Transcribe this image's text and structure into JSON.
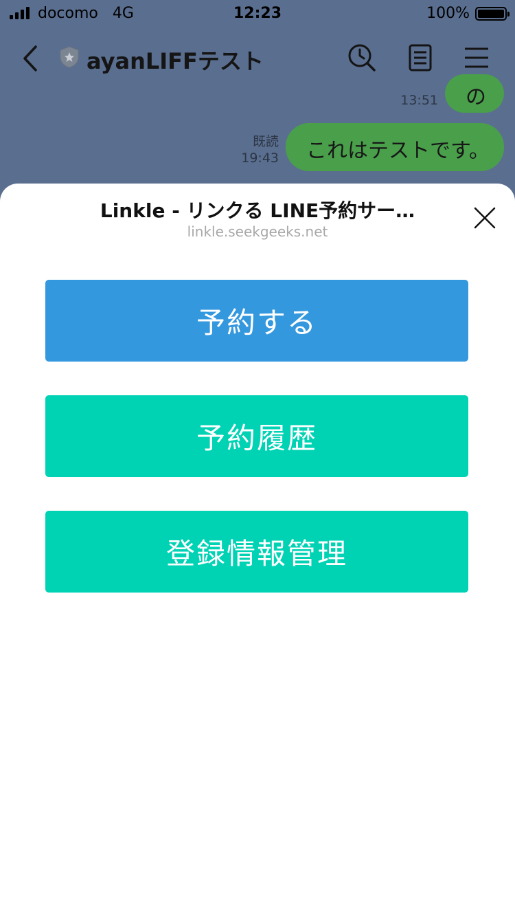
{
  "status_bar": {
    "carrier": "docomo",
    "network": "4G",
    "time": "12:23",
    "battery": "100%"
  },
  "chat_header": {
    "title": "ayanLIFFテスト",
    "icons": [
      "back-icon",
      "shield-icon",
      "search-clock-icon",
      "notes-icon",
      "menu-icon"
    ]
  },
  "messages": [
    {
      "text": "の",
      "time": "13:51",
      "read": ""
    },
    {
      "text": "これはテストです。",
      "time": "19:43",
      "read": "既読"
    }
  ],
  "liff_sheet": {
    "title": "Linkle - リンクる LINE予約サー…",
    "url": "linkle.seekgeeks.net",
    "buttons": {
      "reserve": "予約する",
      "history": "予約履歴",
      "profile": "登録情報管理"
    }
  },
  "colors": {
    "overlay_bg": "#5a6e8f",
    "bubble_green": "#4a9f4b",
    "reserve_blue": "#3498de",
    "teal": "#00d2b4"
  }
}
